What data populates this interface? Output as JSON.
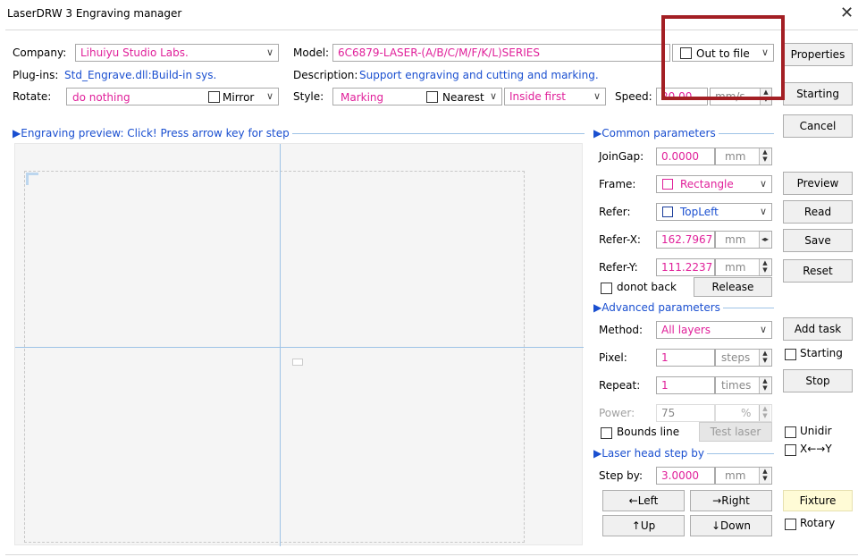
{
  "window": {
    "title": "LaserDRW 3 Engraving manager"
  },
  "top": {
    "company_label": "Company:",
    "company_value": "Lihuiyu Studio Labs.",
    "model_label": "Model:",
    "model_value": "6C6879-LASER-(A/B/C/M/F/K/L)SERIES",
    "plugins_label": "Plug-ins:",
    "plugins_value": "Std_Engrave.dll:Build-in sys.",
    "description_label": "Description:",
    "description_value": "Support engraving and cutting and marking.",
    "rotate_label": "Rotate:",
    "rotate_value": "do nothing",
    "mirror_label": "Mirror",
    "style_label": "Style:",
    "style_value": "Marking",
    "nearest_label": "Nearest",
    "inside_first_value": "Inside first",
    "speed_label": "Speed:",
    "speed_value": "20.00",
    "speed_unit": "mm/s",
    "out_to_file_label": "Out to file"
  },
  "preview": {
    "label": "Engraving preview: Click! Press arrow key for step"
  },
  "common": {
    "section_label": "Common parameters",
    "joingap_label": "JoinGap:",
    "joingap_value": "0.0000",
    "joingap_unit": "mm",
    "frame_label": "Frame:",
    "frame_value": "Rectangle",
    "refer_label": "Refer:",
    "refer_value": "TopLeft",
    "referx_label": "Refer-X:",
    "referx_value": "162.7967",
    "referx_unit": "mm",
    "refery_label": "Refer-Y:",
    "refery_value": "111.2237",
    "refery_unit": "mm",
    "donot_back_label": "donot back",
    "release_label": "Release"
  },
  "advanced": {
    "section_label": "Advanced parameters",
    "method_label": "Method:",
    "method_value": "All layers",
    "pixel_label": "Pixel:",
    "pixel_value": "1",
    "pixel_unit": "steps",
    "repeat_label": "Repeat:",
    "repeat_value": "1",
    "repeat_unit": "times",
    "power_label": "Power:",
    "power_value": "75",
    "power_unit": "%",
    "bounds_label": "Bounds line",
    "test_laser_label": "Test laser"
  },
  "step": {
    "section_label": "Laser head step by",
    "stepby_label": "Step by:",
    "stepby_value": "3.0000",
    "stepby_unit": "mm",
    "left_label": "←Left",
    "right_label": "→Right",
    "up_label": "↑Up",
    "down_label": "↓Down"
  },
  "side": {
    "properties": "Properties",
    "starting": "Starting",
    "cancel": "Cancel",
    "preview": "Preview",
    "read": "Read",
    "save": "Save",
    "reset": "Reset",
    "add_task": "Add task",
    "starting_cb": "Starting",
    "stop": "Stop",
    "unidir": "Unidir",
    "xy": "X←→Y",
    "fixture": "Fixture",
    "rotary": "Rotary"
  },
  "colors": {
    "highlight_box": "#a31f24",
    "value_pink": "#e0209a",
    "link_blue": "#1a4fd0",
    "fixture_bg": "#fffbd6"
  }
}
